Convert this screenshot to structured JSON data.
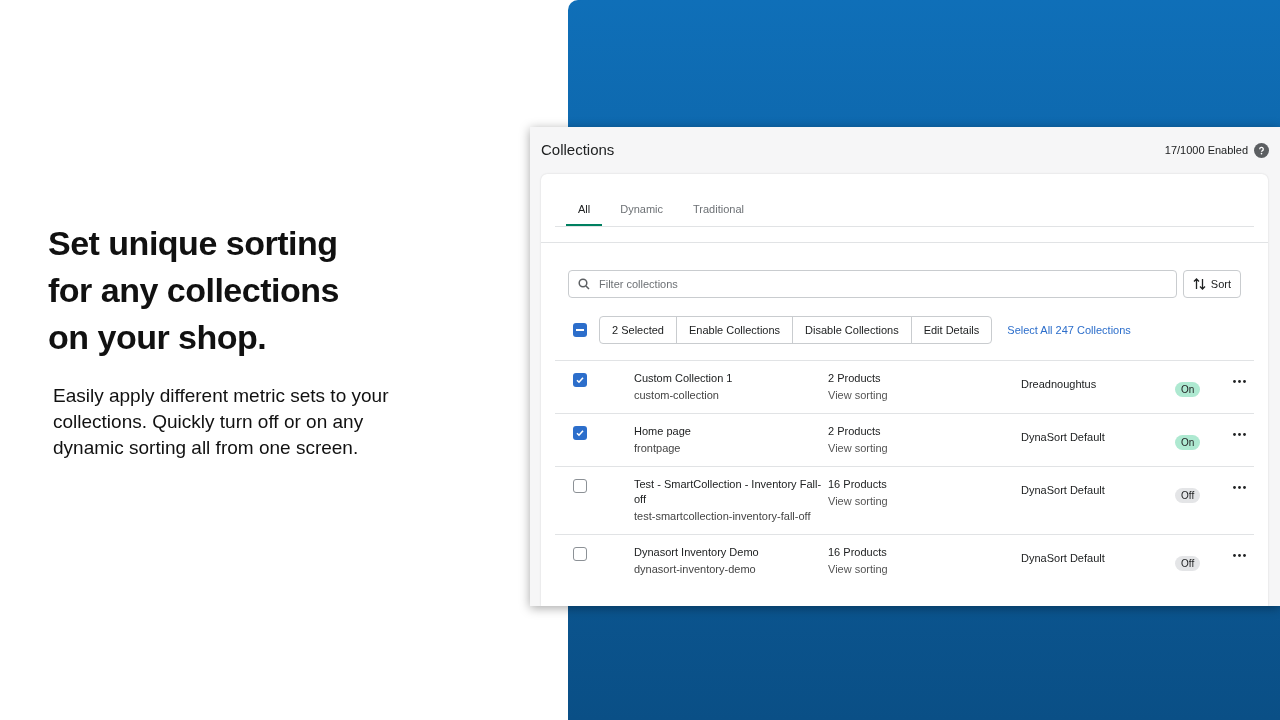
{
  "headline": "Set unique sorting for any collections on your shop.",
  "description": "Easily apply different metric sets to your collections. Quickly turn off or on any dynamic sorting all from one screen.",
  "app": {
    "title": "Collections",
    "enabled_count": "17/1000 Enabled",
    "tabs": [
      {
        "label": "All",
        "selected": true
      },
      {
        "label": "Dynamic",
        "selected": false
      },
      {
        "label": "Traditional",
        "selected": false
      }
    ],
    "search": {
      "placeholder": "Filter collections"
    },
    "sort_button": "Sort",
    "bulk": {
      "indeterminate": true,
      "actions": [
        "2 Selected",
        "Enable Collections",
        "Disable Collections",
        "Edit Details"
      ],
      "select_all_link": "Select All 247 Collections"
    },
    "rows": [
      {
        "checked": true,
        "name": "Custom Collection 1",
        "handle": "custom-collection",
        "products": "2 Products",
        "link": "View sorting",
        "metric_set": "Dreadnoughtus",
        "status": {
          "label": "On",
          "on": true
        }
      },
      {
        "checked": true,
        "name": "Home page",
        "handle": "frontpage",
        "products": "2 Products",
        "link": "View sorting",
        "metric_set": "DynaSort Default",
        "status": {
          "label": "On",
          "on": true
        }
      },
      {
        "checked": false,
        "name": "Test - SmartCollection - Inventory Fall-off",
        "handle": "test-smartcollection-inventory-fall-off",
        "products": "16 Products",
        "link": "View sorting",
        "metric_set": "DynaSort Default",
        "status": {
          "label": "Off",
          "on": false
        }
      },
      {
        "checked": false,
        "name": "Dynasort Inventory Demo",
        "handle": "dynasort-inventory-demo",
        "products": "16 Products",
        "link": "View sorting",
        "metric_set": "DynaSort Default",
        "status": {
          "label": "Off",
          "on": false
        }
      }
    ]
  }
}
